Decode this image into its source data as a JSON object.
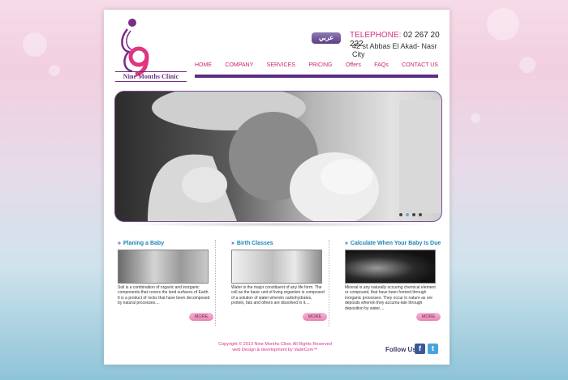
{
  "site": {
    "name": "Nine Months Clinic",
    "language_button": "عربي"
  },
  "contact": {
    "phone_label": "TELEPHONE:",
    "phone": "02 267 20 222",
    "address": "42 st Abbas El Akad- Nasr City"
  },
  "nav": [
    "HOME",
    "COMPANY",
    "SERVICES",
    "PRICING",
    "Offers",
    "FAQs",
    "CONTACT US"
  ],
  "slider": {
    "slide_count": 4,
    "active_index": 1
  },
  "columns": [
    {
      "title": "Planing a Baby",
      "text": "Soil is a combination of organic and inorganic components that covers the land surfaces of Earth. It is a product of rocks that have been decomposed by natural processes....",
      "button": "MORE"
    },
    {
      "title": "Birth Classes",
      "text": "Water is the major constituent of any life form. The cell as the basic unit of living organism is composed of a solution of water wherein carbohydrates, protein, fats and others are dissolved in it....",
      "button": "MORE"
    },
    {
      "title": "Calculate When Your Baby Is Due",
      "text": "Mineral is any naturally occuring chemical element or compound, that have been formed through inorganic processes. They occur in nature as ore deposits wherein they accumu-late through deposition by water....",
      "button": "MORE"
    }
  ],
  "footer": {
    "copyright": "Copyright © 2013 Nine Months Clinic All Rights Reserved",
    "credit": "web Design & development by VadeCom™",
    "follow_label": "Follow Us"
  },
  "social": [
    {
      "name": "facebook-icon",
      "glyph": "f",
      "color": "#3b5998"
    },
    {
      "name": "twitter-icon",
      "glyph": "t",
      "color": "#4aa3df"
    }
  ],
  "colors": {
    "brand_pink": "#d6338a",
    "brand_purple": "#5d2b84",
    "heading_blue": "#1d84b9"
  }
}
